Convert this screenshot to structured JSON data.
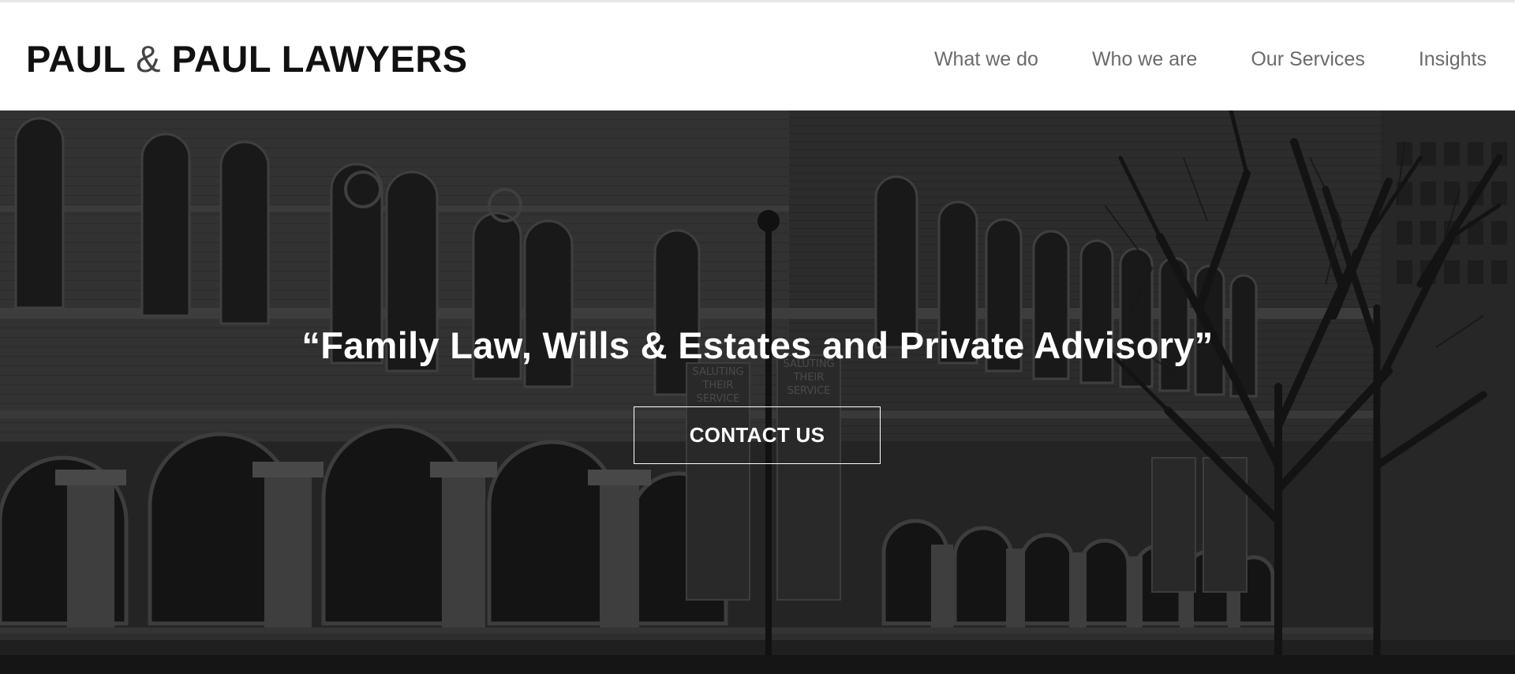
{
  "header": {
    "logo_part1": "PAUL ",
    "logo_amp": "&",
    "logo_part2": " PAUL LAWYERS",
    "nav": [
      {
        "label": "What we do"
      },
      {
        "label": "Who we are"
      },
      {
        "label": "Our Services"
      },
      {
        "label": "Insights"
      }
    ]
  },
  "hero": {
    "quote": "“Family Law, Wills & Estates and Private Advisory”",
    "cta_label": "CONTACT US",
    "background": "grayscale photo of a sandstone heritage building with arched colonnade and bare trees"
  },
  "colors": {
    "logo": "#111111",
    "nav_text": "#6b6b6b",
    "hero_text": "#ffffff",
    "hero_bg": "#2d2d2d"
  }
}
